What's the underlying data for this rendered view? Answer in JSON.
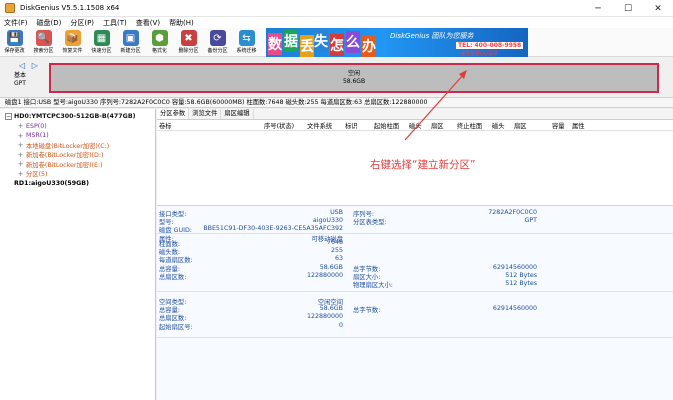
{
  "window": {
    "title": "DiskGenius V5.5.1.1508 x64",
    "minimize": "─",
    "maximize": "☐",
    "close": "✕"
  },
  "menu": [
    "文件(F)",
    "磁盘(D)",
    "分区(P)",
    "工具(T)",
    "查看(V)",
    "帮助(H)"
  ],
  "toolbar": [
    {
      "label": "保存更改",
      "icon": "save-icon",
      "color": "#3a78c8"
    },
    {
      "label": "搜索分区",
      "icon": "search-icon",
      "color": "#d9534f"
    },
    {
      "label": "恢复文件",
      "icon": "recover-icon",
      "color": "#f0a030"
    },
    {
      "label": "快速分区",
      "icon": "quick-partition-icon",
      "color": "#2e8b57"
    },
    {
      "label": "新建分区",
      "icon": "new-partition-icon",
      "color": "#3a78c8"
    },
    {
      "label": "格式化",
      "icon": "format-icon",
      "color": "#5a9e3a"
    },
    {
      "label": "删除分区",
      "icon": "delete-partition-icon",
      "color": "#c94040"
    },
    {
      "label": "备份分区",
      "icon": "backup-icon",
      "color": "#4a4a9a"
    },
    {
      "label": "系统迁移",
      "icon": "migrate-icon",
      "color": "#2a8fd0"
    }
  ],
  "banner": {
    "chars": [
      "数",
      "据",
      "丢",
      "失",
      "怎",
      "么",
      "办"
    ],
    "slogan": "DiskGenius 团队为您服务",
    "tel": "TEL: 400-008-9958",
    "qq": "减减客服QQ请见"
  },
  "disk": {
    "nav": "◁ ▷",
    "type_line1": "基本",
    "type_line2": "GPT",
    "part_name": "空闲",
    "part_size": "58.6GB"
  },
  "infoline": "磁盘1 接口:USB  型号:aigoU330  序列号:7282A2F0C0C0  容量:58.6GB(60000MB)  柱面数:7648  磁头数:255  每道扇区数:63  总扇区数:122880000",
  "tree": [
    {
      "text": "HD0:YMTCPC300-512GB-B(477GB)",
      "level": 0,
      "kind": "disk",
      "ctrl": "−"
    },
    {
      "text": "ESP(0)",
      "level": 1,
      "kind": "part",
      "ctrl": "+"
    },
    {
      "text": "MSR(1)",
      "level": 1,
      "kind": "part",
      "ctrl": "+"
    },
    {
      "text": "本地磁盘(BitLocker加密)(C:)",
      "level": 1,
      "kind": "sel",
      "ctrl": "+"
    },
    {
      "text": "新加卷(BitLocker加密)(D:)",
      "level": 1,
      "kind": "sel",
      "ctrl": "+"
    },
    {
      "text": "新加卷(BitLocker加密)(E:)",
      "level": 1,
      "kind": "sel",
      "ctrl": "+"
    },
    {
      "text": "分区(5)",
      "level": 1,
      "kind": "sel",
      "ctrl": "+"
    },
    {
      "text": "RD1:aigoU330(59GB)",
      "level": 0,
      "kind": "rd",
      "ctrl": ""
    }
  ],
  "tabs": [
    "分区参数",
    "浏览文件",
    "扇区编辑"
  ],
  "columns": [
    "卷标",
    "序号(状态)",
    "文件系统",
    "标识",
    "起始柱面",
    "磁头",
    "扇区",
    "终止柱面",
    "磁头",
    "扇区",
    "容量",
    "属性"
  ],
  "annotation": "右键选择“建立新分区”",
  "props": {
    "s1": [
      {
        "k": "接口类型:",
        "v": "USB",
        "k2": "序列号:",
        "v2": "7282A2F0C0C0"
      },
      {
        "k": "型号:",
        "v": "aigoU330",
        "k2": "分区表类型:",
        "v2": "GPT"
      },
      {
        "k": "磁盘 GUID:",
        "v": "BBE51C91-DF30-403E-9263-CE5A35AFC392",
        "k2": "",
        "v2": ""
      },
      {
        "k": "属性:",
        "v": "可移动磁盘",
        "k2": "",
        "v2": ""
      }
    ],
    "s2": [
      {
        "k": "柱面数:",
        "v": "7648",
        "k2": "",
        "v2": ""
      },
      {
        "k": "磁头数:",
        "v": "255",
        "k2": "",
        "v2": ""
      },
      {
        "k": "每道扇区数:",
        "v": "63",
        "k2": "",
        "v2": ""
      },
      {
        "k": "总容量:",
        "v": "58.6GB",
        "k2": "总字节数:",
        "v2": "62914560000"
      },
      {
        "k": "总扇区数:",
        "v": "122880000",
        "k2": "扇区大小:",
        "v2": "512 Bytes"
      },
      {
        "k": "",
        "v": "",
        "k2": "物理扇区大小:",
        "v2": "512 Bytes"
      }
    ],
    "s3": [
      {
        "k": "空间类型:",
        "v": "空闲空间",
        "k2": "",
        "v2": ""
      },
      {
        "k": "总容量:",
        "v": "58.6GB",
        "k2": "总字节数:",
        "v2": "62914560000"
      },
      {
        "k": "总扇区数:",
        "v": "122880000",
        "k2": "",
        "v2": ""
      },
      {
        "k": "起始扇区号:",
        "v": "0",
        "k2": "",
        "v2": ""
      }
    ]
  }
}
